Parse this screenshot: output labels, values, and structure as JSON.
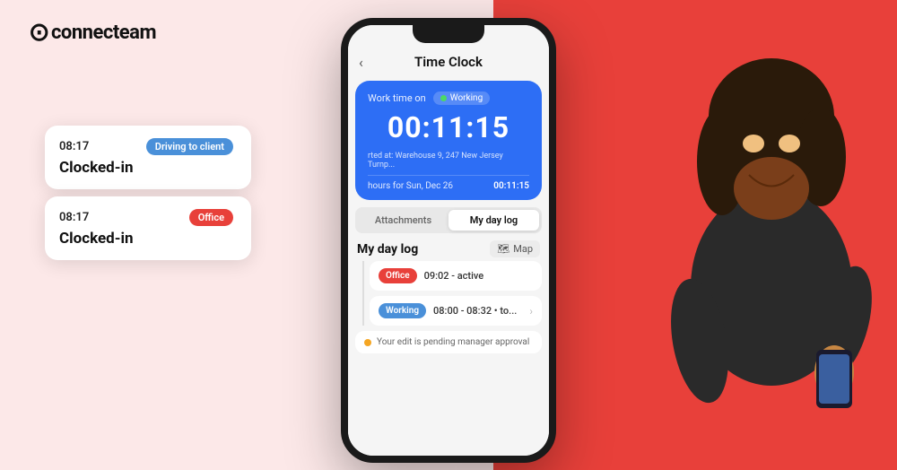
{
  "logo": {
    "icon": "©",
    "text": "connecteam"
  },
  "notifications": [
    {
      "time": "08:17",
      "badge_label": "Driving to client",
      "badge_class": "badge-blue",
      "status": "Clocked-in"
    },
    {
      "time": "08:17",
      "badge_label": "Office",
      "badge_class": "badge-red",
      "status": "Clocked-in"
    }
  ],
  "phone": {
    "header_title": "Time Clock",
    "back_icon": "‹",
    "timer_card": {
      "work_label": "Work time on",
      "working_text": "Working",
      "timer": "00:11:15",
      "location": "rted at: Warehouse 9, 247 New Jersey Turnp...",
      "footer_label": "hours for Sun, Dec 26",
      "footer_time": "00:11:15"
    },
    "tabs": [
      {
        "label": "Attachments",
        "active": false
      },
      {
        "label": "My day log",
        "active": true
      }
    ],
    "daylog": {
      "title": "My day log",
      "map_label": "Map",
      "entries": [
        {
          "badge": "Office",
          "badge_class": "badge-office",
          "time": "09:02 - active"
        },
        {
          "badge": "Working",
          "badge_class": "badge-working",
          "time": "08:00 - 08:32 • to...",
          "arrow": true
        }
      ],
      "pending_text": "Your edit is pending manager approval"
    }
  },
  "colors": {
    "bg_left": "#fce8e8",
    "bg_right": "#e8403a",
    "phone_border": "#1a1a1a",
    "timer_bg": "#2d6ef5"
  }
}
